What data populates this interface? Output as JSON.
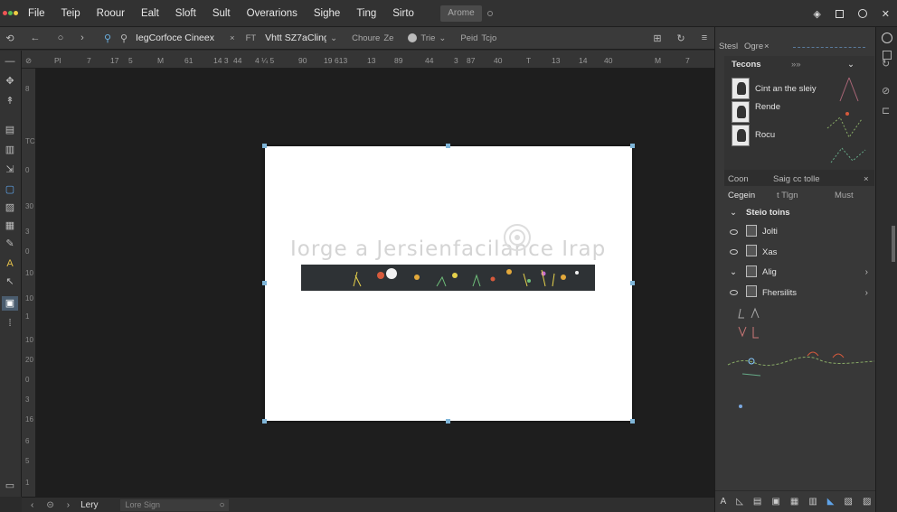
{
  "menubar": {
    "items": [
      "File",
      "Teip",
      "Roour",
      "Ealt",
      "Sloft",
      "Sult",
      "Overarions",
      "Sighe",
      "Ting",
      "Sirto"
    ],
    "search_label": "Arome",
    "window_controls": [
      "pin-icon",
      "restore-icon",
      "circle-icon",
      "close-icon"
    ]
  },
  "options": {
    "search_value": "IegCorfoce Cineex",
    "clear_label": "×",
    "font_toggle_label": "FT",
    "font_name": "Vhtt SZ7aCling",
    "chevron": "⌄",
    "option1_label": "Choure",
    "option1_value": "Ze",
    "option2_label": "Trie",
    "option3_label": "Peid",
    "option3_value": "Tcjo"
  },
  "ruler": {
    "ticks": [
      "Pl",
      "7",
      "17",
      "5",
      "M",
      "61",
      "14 3",
      "44",
      "4 ¼ 5",
      "90",
      "19",
      "613",
      "13",
      "89",
      "44",
      "3",
      "87",
      "40",
      "T",
      "13",
      "14",
      "40",
      "M",
      "7"
    ]
  },
  "vruler": {
    "ticks": [
      "8",
      "TC",
      "0",
      "30",
      "3",
      "0",
      "10",
      "10",
      "1",
      "10",
      "20",
      "0",
      "3",
      "16",
      "6",
      "5",
      "1"
    ]
  },
  "artboard": {
    "headline": "Iorge a Jersienfacilance Irapl",
    "accent_colors": [
      "#e3a93b",
      "#d65a3c",
      "#6fbf7a",
      "#e6d14b",
      "#c96bd1",
      "#f2f2f2"
    ]
  },
  "statusbar": {
    "doc_label": "Lery",
    "field_placeholder": "Lore Sign"
  },
  "panel": {
    "header": {
      "tab1": "Stesl",
      "tab2": "Ogre",
      "close": "×"
    },
    "layers_tab": "Tecons",
    "layers_tab2": "»»",
    "layers": [
      {
        "label": "Cint an the sleiy"
      },
      {
        "label": "Rende"
      },
      {
        "label": "Rocu"
      }
    ],
    "sub_tabs": [
      "Coon",
      "Saig",
      "cc tolle"
    ],
    "sub_label_left": "Cegein",
    "sub_label_mid": "t Tlgn",
    "sub_label_right": "Must",
    "styles_title": "Steio toins",
    "styles": [
      {
        "label": "Jolti",
        "icon": "image-icon"
      },
      {
        "label": "Xas",
        "icon": "figure-icon"
      },
      {
        "label": "Alig",
        "icon": "align-icon",
        "expander": "chevron-down"
      },
      {
        "label": "Fhersilits",
        "icon": "brush-icon"
      }
    ],
    "bottom_icons": [
      "text-icon",
      "shape-icon",
      "layers-icon",
      "image-icon",
      "grid-icon",
      "stack-icon",
      "brush-icon",
      "fill-icon",
      "link-icon"
    ],
    "accent": "#4a5c6e"
  }
}
